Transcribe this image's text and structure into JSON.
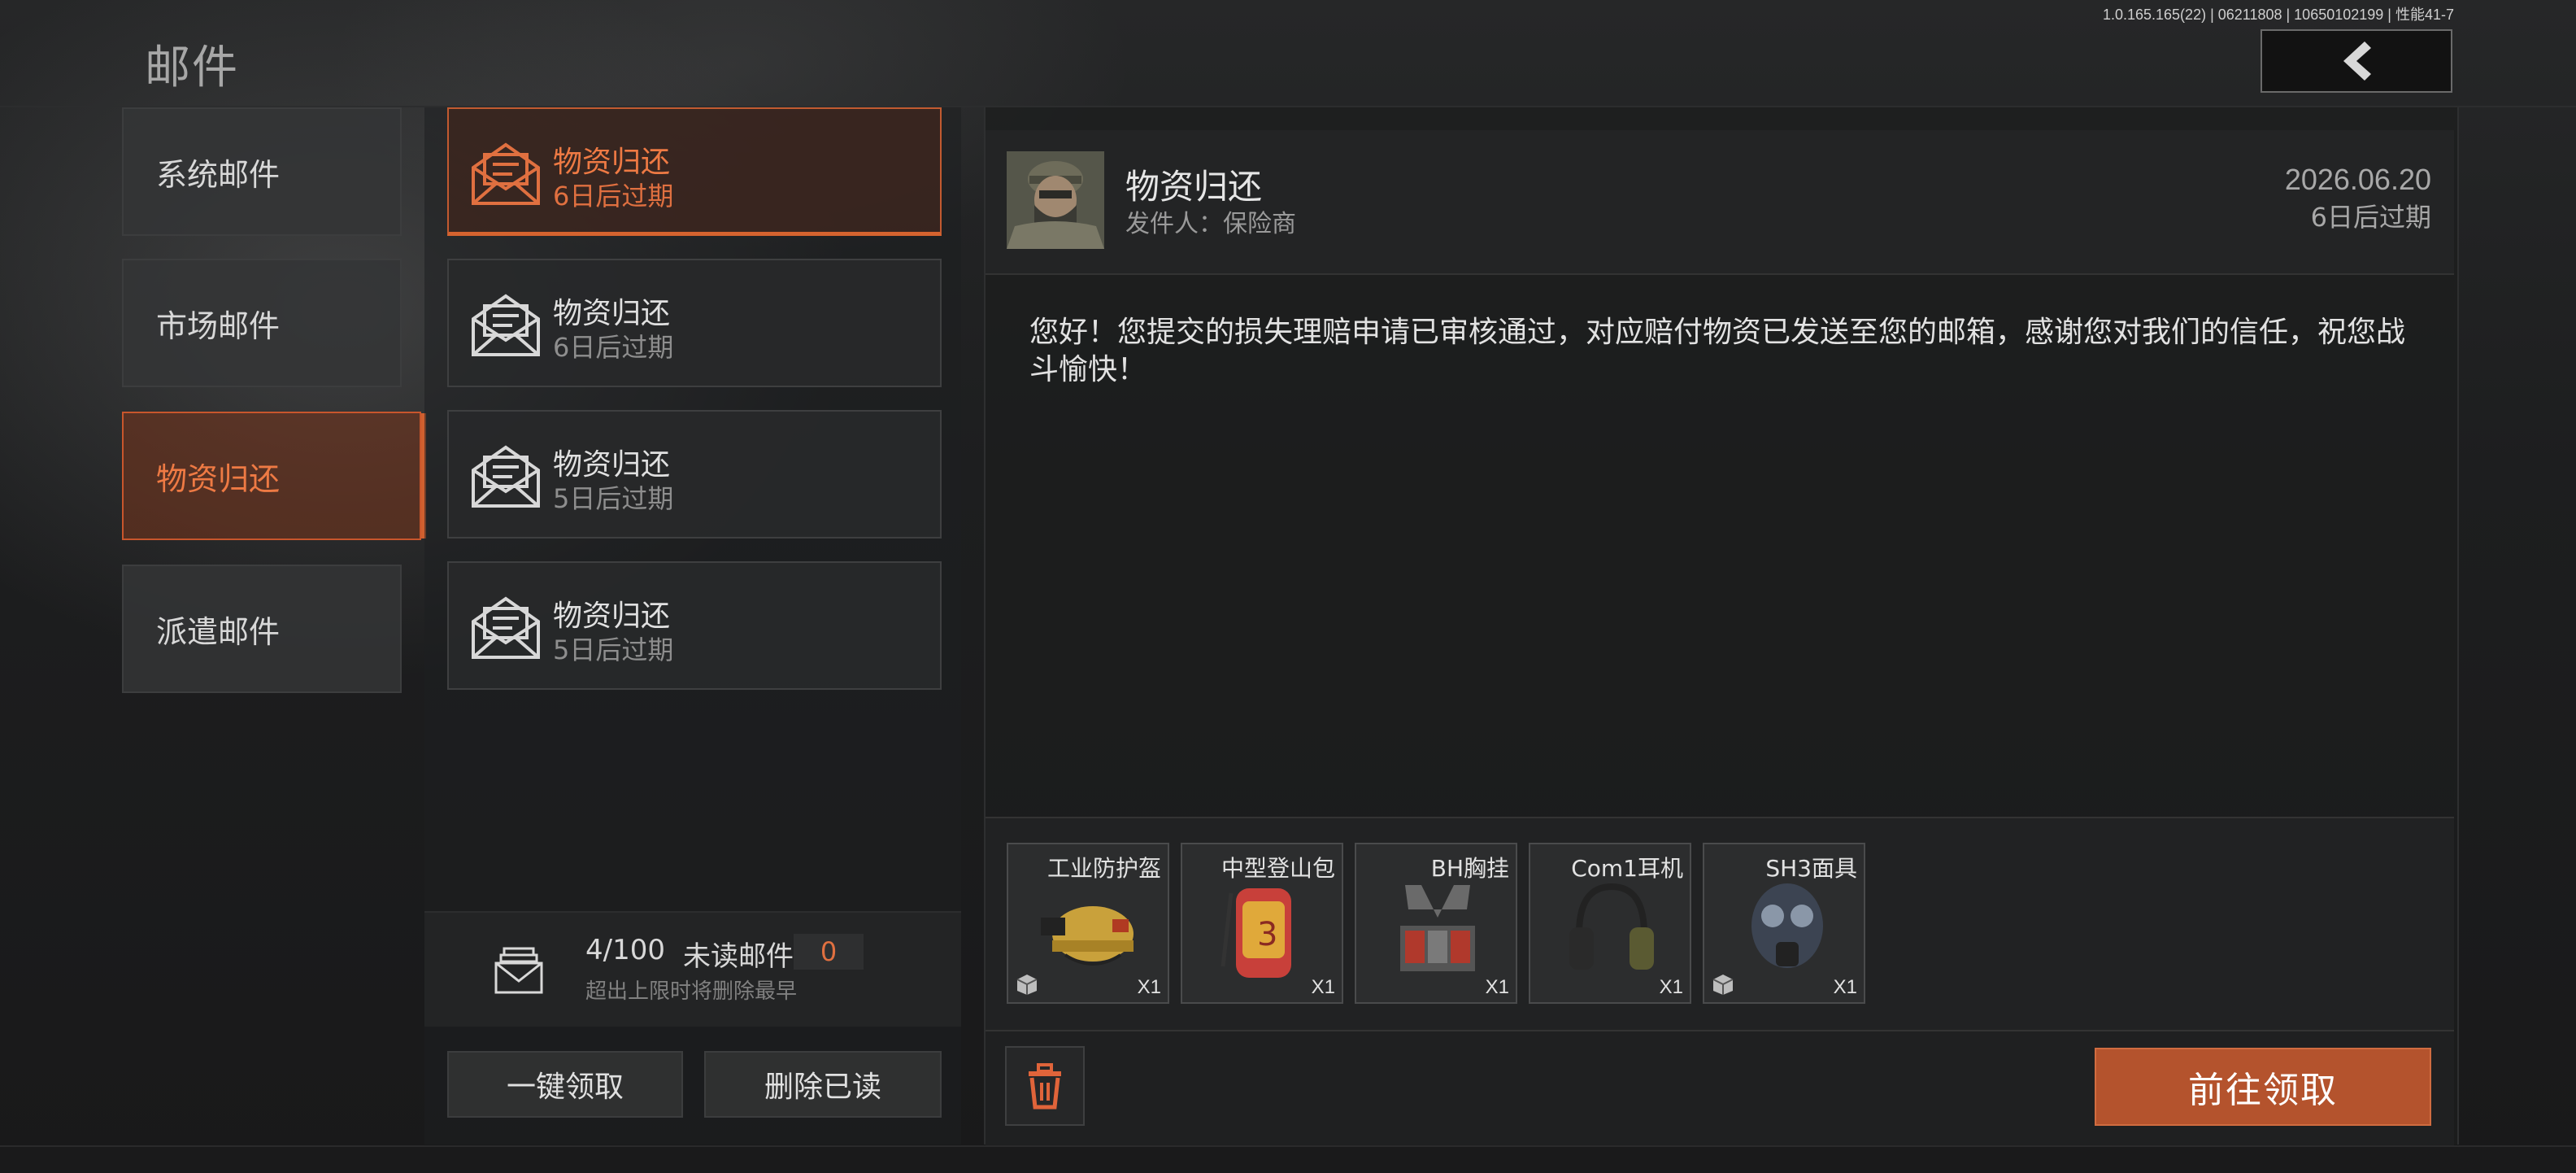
{
  "header": {
    "title": "邮件",
    "version": "1.0.165.165(22) | 06211808 | 10650102199 | 性能41-7"
  },
  "categories": [
    {
      "label": "系统邮件"
    },
    {
      "label": "市场邮件"
    },
    {
      "label": "物资归还"
    },
    {
      "label": "派遣邮件"
    }
  ],
  "mails": [
    {
      "title": "物资归还",
      "expiry": "6日后过期"
    },
    {
      "title": "物资归还",
      "expiry": "6日后过期"
    },
    {
      "title": "物资归还",
      "expiry": "5日后过期"
    },
    {
      "title": "物资归还",
      "expiry": "5日后过期"
    }
  ],
  "counter": {
    "count": "4/100",
    "unread_label": "未读邮件",
    "unread_value": "0",
    "note": "超出上限时将删除最早"
  },
  "actions": {
    "claim_all": "一键领取",
    "delete_read": "删除已读",
    "claim": "前往领取"
  },
  "detail": {
    "title": "物资归还",
    "sender": "发件人：保险商",
    "date": "2026.06.20",
    "expiry": "6日后过期",
    "body": "您好！您提交的损失理赔申请已审核通过，对应赔付物资已发送至您的邮箱，感谢您对我们的信任，祝您战斗愉快！"
  },
  "attachments": [
    {
      "name": "工业防护盔",
      "qty": "X1"
    },
    {
      "name": "中型登山包",
      "qty": "X1"
    },
    {
      "name": "BH胸挂",
      "qty": "X1"
    },
    {
      "name": "Com1耳机",
      "qty": "X1"
    },
    {
      "name": "SH3面具",
      "qty": "X1"
    }
  ],
  "colors": {
    "accent": "#d5632f",
    "claim_button": "#b4532d"
  },
  "icons": [
    "back-chevron-icon",
    "envelope-open-icon",
    "mail-stack-icon",
    "trash-icon",
    "box-icon"
  ]
}
